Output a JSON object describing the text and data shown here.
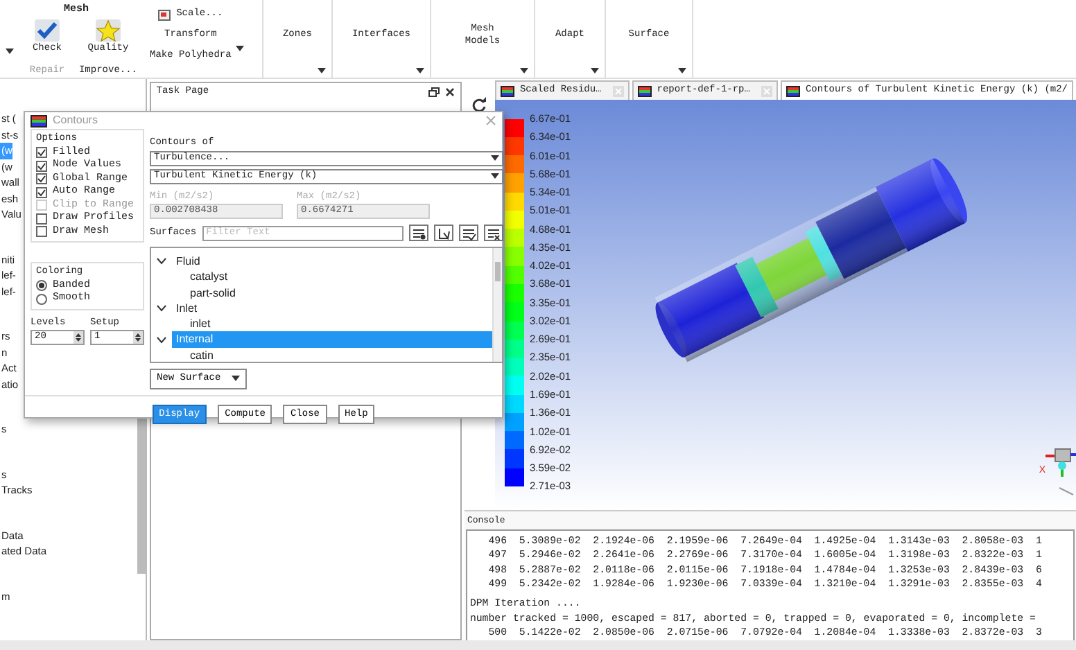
{
  "ribbon": {
    "mesh": {
      "title": "Mesh",
      "big_buttons": [
        {
          "label": "Check",
          "kind": "check",
          "below": {
            "label": "Repair",
            "disabled": true
          }
        },
        {
          "label": "Quality",
          "kind": "star",
          "below": {
            "label": "Improve...",
            "disabled": false
          }
        }
      ],
      "small_buttons": [
        {
          "label": "Scale...",
          "kind": "icon"
        },
        {
          "label": "Transform",
          "kind": "plain"
        },
        {
          "label": "Make Polyhedra",
          "kind": "plain"
        }
      ]
    },
    "groups": [
      {
        "label": "Zones"
      },
      {
        "label": "Interfaces"
      },
      {
        "label": "Mesh Models"
      },
      {
        "label": "Adapt"
      },
      {
        "label": "Surface"
      }
    ]
  },
  "model_tree": {
    "groups": [
      {
        "items": [
          {
            "label": "st (",
            "selected": false
          },
          {
            "label": "st-s",
            "selected": false
          },
          {
            "label": "(w",
            "selected": true
          },
          {
            "label": "(w",
            "selected": false
          },
          {
            "label": "wall",
            "selected": false
          },
          {
            "label": "esh",
            "selected": false
          },
          {
            "label": "Valu",
            "selected": false
          }
        ]
      },
      {
        "items": [
          {
            "label": "niti",
            "selected": false
          },
          {
            "label": "lef-",
            "selected": false
          },
          {
            "label": "lef-",
            "selected": false
          }
        ]
      },
      {
        "items": [
          {
            "label": "rs",
            "selected": false
          },
          {
            "label": "n",
            "selected": false
          },
          {
            "label": "Act",
            "selected": false
          },
          {
            "label": "atio",
            "selected": false
          }
        ]
      },
      {
        "items": [
          {
            "label": "s",
            "selected": false
          }
        ]
      },
      {
        "items": [
          {
            "label": "s",
            "selected": false
          },
          {
            "label": "Tracks",
            "selected": false
          }
        ]
      },
      {
        "items": [
          {
            "label": "Data",
            "selected": false
          },
          {
            "label": "ated Data",
            "selected": false
          }
        ]
      },
      {
        "items": [
          {
            "label": "m",
            "selected": false
          }
        ]
      }
    ]
  },
  "task_page": {
    "title": "Task Page"
  },
  "graphics": {
    "tabs": [
      {
        "label": "Scaled Residu…",
        "selected": false,
        "closable": true
      },
      {
        "label": "report-def-1-rp…",
        "selected": false,
        "closable": true
      },
      {
        "label": "Contours of Turbulent Kinetic Energy (k) (m2/",
        "selected": true,
        "closable": false
      }
    ],
    "legend": {
      "labels": [
        "6.67e-01",
        "6.34e-01",
        "6.01e-01",
        "5.68e-01",
        "5.34e-01",
        "5.01e-01",
        "4.68e-01",
        "4.35e-01",
        "4.02e-01",
        "3.68e-01",
        "3.35e-01",
        "3.02e-01",
        "2.69e-01",
        "2.35e-01",
        "2.02e-01",
        "1.69e-01",
        "1.36e-01",
        "1.02e-01",
        "6.92e-02",
        "3.59e-02",
        "2.71e-03"
      ]
    },
    "axes": {
      "x_label": "X"
    }
  },
  "console": {
    "title": "Console",
    "blocks": [
      {
        "lines": [
          "   496  5.3089e-02  2.1924e-06  2.1959e-06  7.2649e-04  1.4925e-04  1.3143e-03  2.8058e-03  1",
          "   497  5.2946e-02  2.2641e-06  2.2769e-06  7.3170e-04  1.6005e-04  1.3198e-03  2.8322e-03  1",
          "   498  5.2887e-02  2.0118e-06  2.0115e-06  7.1918e-04  1.4784e-04  1.3253e-03  2.8439e-03  6",
          "   499  5.2342e-02  1.9284e-06  1.9230e-06  7.0339e-04  1.3210e-04  1.3291e-03  2.8355e-03  4"
        ]
      },
      {
        "lines": [
          "DPM Iteration ....",
          "number tracked = 1000, escaped = 817, aborted = 0, trapped = 0, evaporated = 0, incomplete =",
          "   500  5.1422e-02  2.0850e-06  2.0715e-06  7.0792e-04  1.2084e-04  1.3338e-03  2.8372e-03  3"
        ]
      }
    ]
  },
  "dialog": {
    "title": "Contours",
    "options": {
      "title": "Options",
      "items": [
        {
          "label": "Filled",
          "checked": true,
          "disabled": false
        },
        {
          "label": "Node Values",
          "checked": true,
          "disabled": false
        },
        {
          "label": "Global Range",
          "checked": true,
          "disabled": false
        },
        {
          "label": "Auto Range",
          "checked": true,
          "disabled": false
        },
        {
          "label": "Clip to Range",
          "checked": false,
          "disabled": true
        },
        {
          "label": "Draw Profiles",
          "checked": false,
          "disabled": false
        },
        {
          "label": "Draw Mesh",
          "checked": false,
          "disabled": false
        }
      ]
    },
    "coloring": {
      "title": "Coloring",
      "choices": [
        {
          "label": "Banded",
          "selected": true
        },
        {
          "label": "Smooth",
          "selected": false
        }
      ]
    },
    "levels": {
      "label": "Levels",
      "value": "20"
    },
    "setup": {
      "label": "Setup",
      "value": "1"
    },
    "contours_of": {
      "label": "Contours of",
      "category": "Turbulence...",
      "variable": "Turbulent Kinetic Energy (k)"
    },
    "min": {
      "label": "Min (m2/s2)",
      "value": "0.002708438"
    },
    "max": {
      "label": "Max (m2/s2)",
      "value": "0.6674271"
    },
    "surfaces": {
      "label": "Surfaces",
      "placeholder": "Filter Text",
      "tree": [
        {
          "label": "Fluid",
          "expanded": true,
          "selected": false,
          "children": [
            {
              "label": "catalyst",
              "selected": false
            },
            {
              "label": "part-solid",
              "selected": false
            }
          ]
        },
        {
          "label": "Inlet",
          "expanded": true,
          "selected": false,
          "children": [
            {
              "label": "inlet",
              "selected": false
            }
          ]
        },
        {
          "label": "Internal",
          "expanded": true,
          "selected": true,
          "children": [
            {
              "label": "catin",
              "selected": false
            }
          ]
        }
      ]
    },
    "new_surface": "New Surface",
    "buttons": [
      {
        "label": "Display",
        "primary": true
      },
      {
        "label": "Compute",
        "primary": false
      },
      {
        "label": "Close",
        "primary": false
      },
      {
        "label": "Help",
        "primary": false
      }
    ]
  }
}
